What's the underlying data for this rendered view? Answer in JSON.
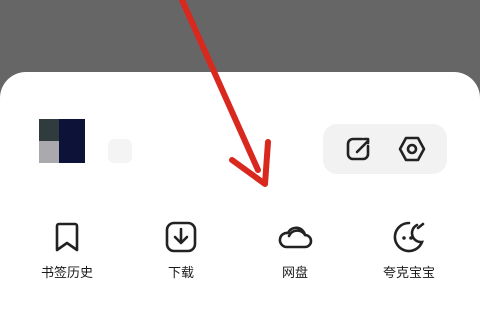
{
  "colors": {
    "overlay": "#666666",
    "sheet": "#ffffff",
    "action_group_bg": "#f2f2f2",
    "icon_stroke": "#222222",
    "arrow": "#d9281e"
  },
  "profile": {
    "avatar_icon": "user-avatar",
    "name": ""
  },
  "actions": [
    {
      "icon": "edit-icon"
    },
    {
      "icon": "settings-icon"
    }
  ],
  "nav": [
    {
      "label": "书签历史",
      "icon": "bookmark-icon"
    },
    {
      "label": "下载",
      "icon": "download-icon"
    },
    {
      "label": "网盘",
      "icon": "cloud-icon"
    },
    {
      "label": "夸克宝宝",
      "icon": "quark-baby-icon"
    }
  ],
  "annotation": {
    "icon": "red-arrow-icon",
    "points_to": "网盘"
  }
}
